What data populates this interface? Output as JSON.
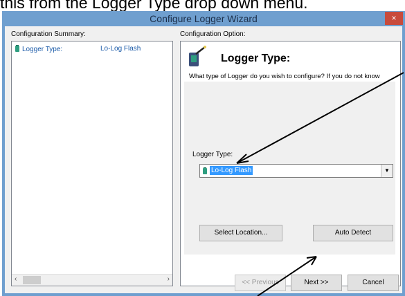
{
  "caption": "this from the Logger Type drop down menu.",
  "window": {
    "title": "Configure Logger Wizard",
    "close_label": "×"
  },
  "summary": {
    "label": "Configuration Summary:",
    "rows": [
      {
        "name": "Logger Type:",
        "value": "Lo-Log Flash"
      }
    ],
    "scroll_left": "‹",
    "scroll_right": "›"
  },
  "option": {
    "label": "Configuration Option:",
    "heading": "Logger Type:",
    "description": "What type of Logger do you wish to configure? If you do not know the logger type, select Unknown - Auto Detect.",
    "field_label": "Logger Type:",
    "selected_value": "Lo-Log Flash",
    "combo_arrow": "▼"
  },
  "buttons": {
    "select_location": "Select Location...",
    "auto_detect": "Auto Detect",
    "previous": "<< Previous",
    "next": "Next >>",
    "cancel": "Cancel"
  },
  "colors": {
    "title_bar": "#6f9fcf",
    "close": "#c84b3c",
    "selection": "#3399ff",
    "link_text": "#1a5aa8"
  },
  "icons": [
    "battery-icon",
    "wand-icon",
    "arrow-annotation-icon"
  ]
}
